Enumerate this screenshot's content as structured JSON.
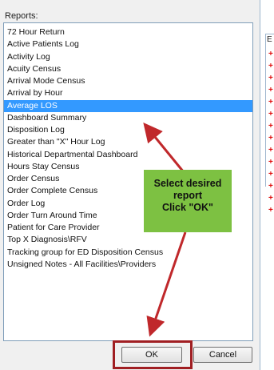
{
  "dialog": {
    "reports_label": "Reports:",
    "items": [
      "72 Hour Return",
      "Active Patients Log",
      "Activity Log",
      "Acuity Census",
      "Arrival Mode Census",
      "Arrival by Hour",
      "Average LOS",
      "Dashboard Summary",
      "Disposition Log",
      "Greater than \"X\" Hour Log",
      "Historical Departmental Dashboard",
      "Hours Stay Census",
      "Order Census",
      "Order Complete Census",
      "Order Log",
      "Order Turn Around Time",
      "Patient for Care Provider",
      "Top X Diagnosis\\RFV",
      "Tracking group for ED Disposition Census",
      "Unsigned Notes - All Facilities\\Providers"
    ],
    "selected_item": "Average LOS",
    "ok_label": "OK",
    "cancel_label": "Cancel"
  },
  "callout": {
    "line1": "Select desired",
    "line2": "report",
    "line3": "Click \"OK\""
  },
  "background_window": {
    "letter": "E"
  },
  "colors": {
    "selection": "#3399ff",
    "callout": "#7dc142",
    "arrow": "#c0282b",
    "highlight_box": "#a01e22"
  }
}
